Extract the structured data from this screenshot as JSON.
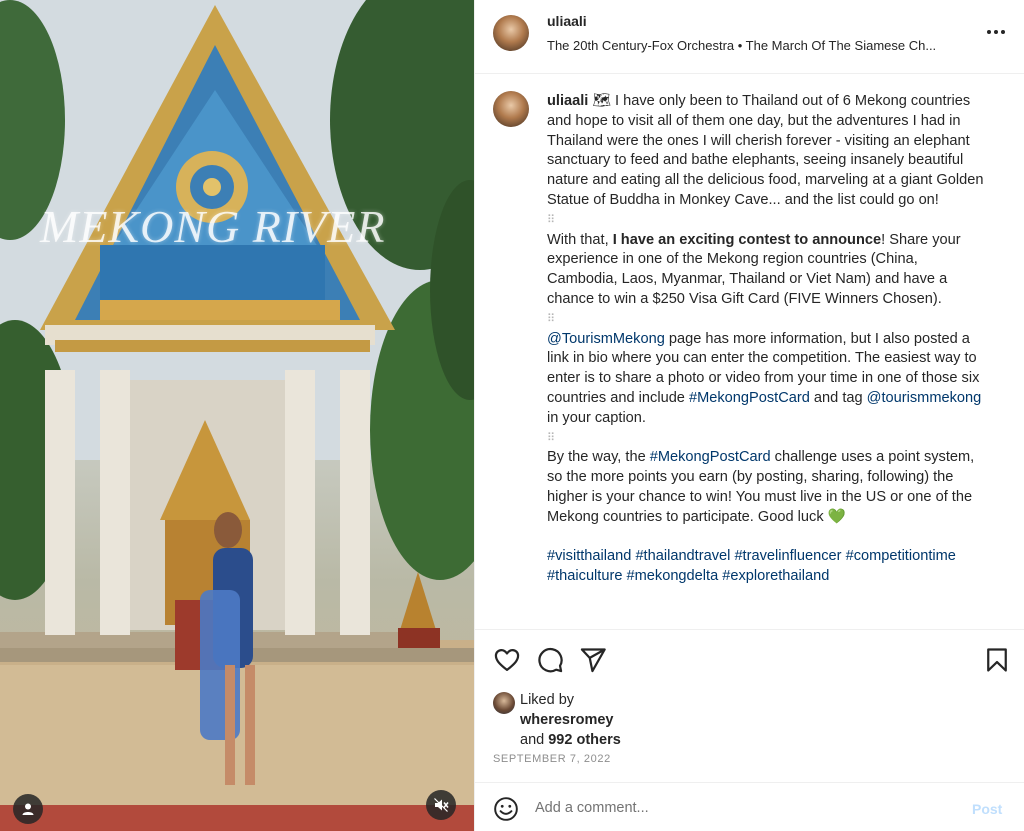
{
  "media": {
    "overlay_text": "MEKONG RIVER",
    "user_icon": "user-tag-icon",
    "mute_icon": "muted-speaker-icon"
  },
  "header": {
    "username": "uliaali",
    "music": "The 20th Century-Fox Orchestra • The March Of The Siamese Ch...",
    "more_icon": "more-horizontal-icon"
  },
  "caption": {
    "username": "uliaali",
    "map_emoji": "🗺",
    "p1": "I have only been to Thailand out of 6 Mekong countries and hope to visit all of them one day, but the adventures I had in Thailand were the ones I will cherish forever - visiting an elephant sanctuary to feed and bathe elephants, seeing insanely beautiful nature and eating all the delicious food, marveling at a giant Golden Statue of Buddha in Monkey Cave... and the list could go on!",
    "dots": "⠿",
    "p2_lead": "With that, ",
    "p2_bold": "I have an exciting contest to announce",
    "p2_rest": "! Share your experience in one of the Mekong region countries (China, Cambodia, Laos, Myanmar, Thailand or Viet Nam) and have a chance to win a $250 Visa Gift Card (FIVE Winners Chosen).",
    "p3_mention": "@TourismMekong",
    "p3_text1": " page has more information, but I also posted a link in bio where you can enter the competition. The easiest way to enter is to share a photo or video from your time in one of those six countries and include ",
    "p3_hashtag": "#MekongPostCard",
    "p3_text2": " and tag ",
    "p3_mention2": "@tourismmekong",
    "p3_text3": " in your caption.",
    "p4_text1": "By the way, the ",
    "p4_hashtag": "#MekongPostCard",
    "p4_text2": " challenge uses a point system, so the more points you earn (by posting, sharing, following) the higher is your chance to win! You must live in the US or one of the Mekong countries to participate. Good luck ",
    "p4_emoji": "💚",
    "hashtags": [
      "#visitthailand",
      "#thailandtravel",
      "#travelinfluencer",
      "#competitiontime",
      "#thaiculture",
      "#mekongdelta",
      "#explorethailand"
    ]
  },
  "actions": {
    "like_icon": "heart-icon",
    "comment_icon": "comment-bubble-icon",
    "share_icon": "paper-plane-icon",
    "save_icon": "bookmark-icon"
  },
  "likes": {
    "liked_by": "Liked by",
    "liker": "wheresromey",
    "and": "and ",
    "others": "992 others",
    "date": "SEPTEMBER 7, 2022"
  },
  "comment": {
    "emoji_icon": "smiley-icon",
    "placeholder": "Add a comment...",
    "post_label": "Post"
  }
}
